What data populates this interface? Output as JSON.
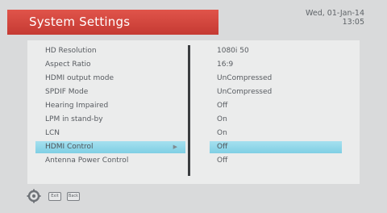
{
  "header": {
    "title": "System Settings",
    "date": "Wed, 01-Jan-14",
    "time": "13:05"
  },
  "settings": [
    {
      "label": "HD Resolution",
      "value": "1080i 50"
    },
    {
      "label": "Aspect Ratio",
      "value": "16:9"
    },
    {
      "label": "HDMI output mode",
      "value": "UnCompressed"
    },
    {
      "label": "SPDIF Mode",
      "value": "UnCompressed"
    },
    {
      "label": "Hearing Impaired",
      "value": "Off"
    },
    {
      "label": "LPM in stand-by",
      "value": "On"
    },
    {
      "label": "LCN",
      "value": "On"
    },
    {
      "label": "HDMI Control",
      "value": "Off",
      "selected": true
    },
    {
      "label": "Antenna Power Control",
      "value": "Off"
    }
  ],
  "footer": {
    "keys": [
      "Exit",
      "Back"
    ]
  },
  "colors": {
    "title_bar": "#d24a42",
    "highlight": "#8fd6e8"
  },
  "icons": {
    "selected_arrow": "chevron-right-icon",
    "nav": "gear-icon"
  }
}
